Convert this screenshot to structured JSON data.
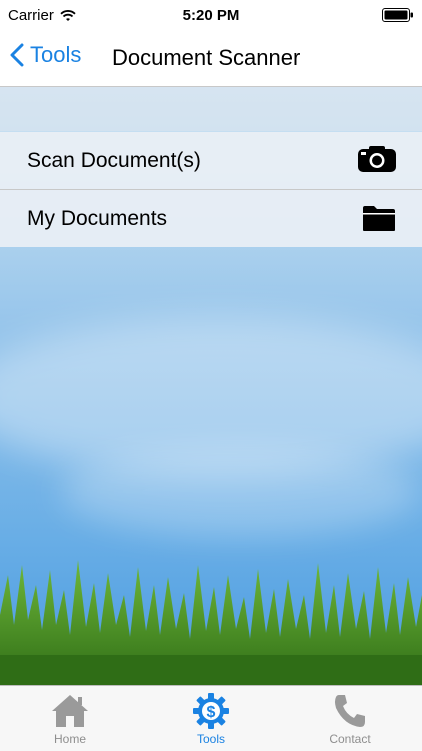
{
  "status_bar": {
    "carrier": "Carrier",
    "time": "5:20 PM"
  },
  "nav_bar": {
    "back_label": "Tools",
    "title": "Document Scanner"
  },
  "list": {
    "items": [
      {
        "label": "Scan Document(s)",
        "icon": "camera-icon"
      },
      {
        "label": "My Documents",
        "icon": "folder-icon"
      }
    ]
  },
  "tab_bar": {
    "tabs": [
      {
        "label": "Home",
        "icon": "home-icon",
        "active": false
      },
      {
        "label": "Tools",
        "icon": "gear-dollar-icon",
        "active": true
      },
      {
        "label": "Contact",
        "icon": "phone-icon",
        "active": false
      }
    ]
  },
  "colors": {
    "accent": "#1a82e2",
    "inactive": "#8e8e8e"
  }
}
